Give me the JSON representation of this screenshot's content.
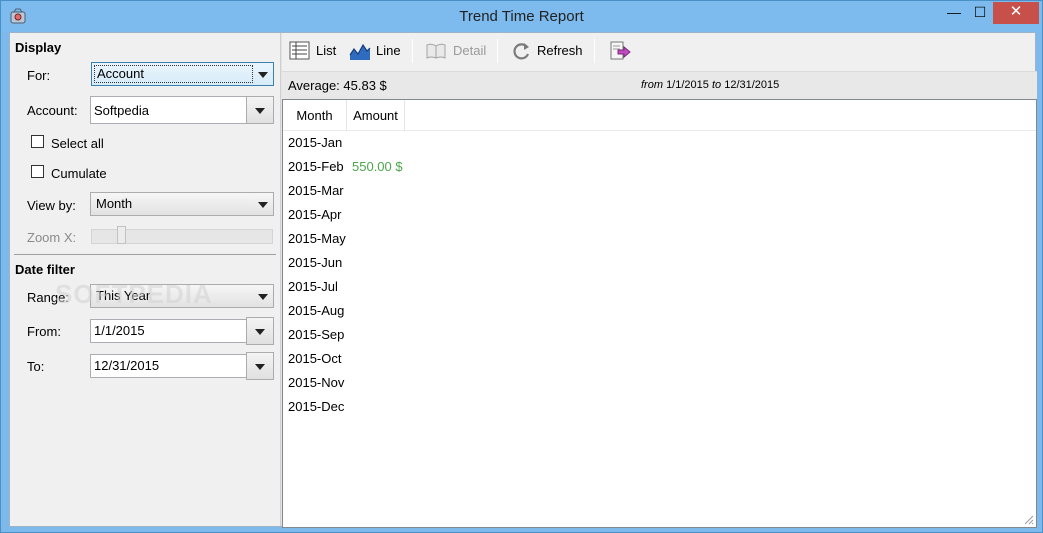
{
  "window": {
    "title": "Trend Time Report",
    "min_label": "—",
    "max_label": "☐",
    "close_label": "✕"
  },
  "display": {
    "section_title": "Display",
    "for_label": "For:",
    "for_value": "Account",
    "account_label": "Account:",
    "account_value": "Softpedia",
    "select_all_label": "Select all",
    "cumulate_label": "Cumulate",
    "view_by_label": "View by:",
    "view_by_value": "Month",
    "zoom_label": "Zoom X:"
  },
  "date_filter": {
    "section_title": "Date filter",
    "range_label": "Range:",
    "range_value": "This Year",
    "from_label": "From:",
    "from_value": "1/1/2015",
    "to_label": "To:",
    "to_value": "12/31/2015"
  },
  "toolbar": {
    "list_label": "List",
    "line_label": "Line",
    "detail_label": "Detail",
    "refresh_label": "Refresh"
  },
  "info": {
    "average": "Average: 45.83 $",
    "range_from_word": "from",
    "range_from": "1/1/2015",
    "range_to_word": "to",
    "range_to": "12/31/2015"
  },
  "table": {
    "headers": [
      "Month",
      "Amount"
    ],
    "rows": [
      {
        "month": "2015-Jan",
        "amount": ""
      },
      {
        "month": "2015-Feb",
        "amount": "550.00 $"
      },
      {
        "month": "2015-Mar",
        "amount": ""
      },
      {
        "month": "2015-Apr",
        "amount": ""
      },
      {
        "month": "2015-May",
        "amount": ""
      },
      {
        "month": "2015-Jun",
        "amount": ""
      },
      {
        "month": "2015-Jul",
        "amount": ""
      },
      {
        "month": "2015-Aug",
        "amount": ""
      },
      {
        "month": "2015-Sep",
        "amount": ""
      },
      {
        "month": "2015-Oct",
        "amount": ""
      },
      {
        "month": "2015-Nov",
        "amount": ""
      },
      {
        "month": "2015-Dec",
        "amount": ""
      }
    ]
  },
  "watermark": "SOFTPEDIA",
  "colors": {
    "amount_positive": "#4ca64c",
    "titlebar": "#7dbbee",
    "close_button": "#c7504a"
  }
}
